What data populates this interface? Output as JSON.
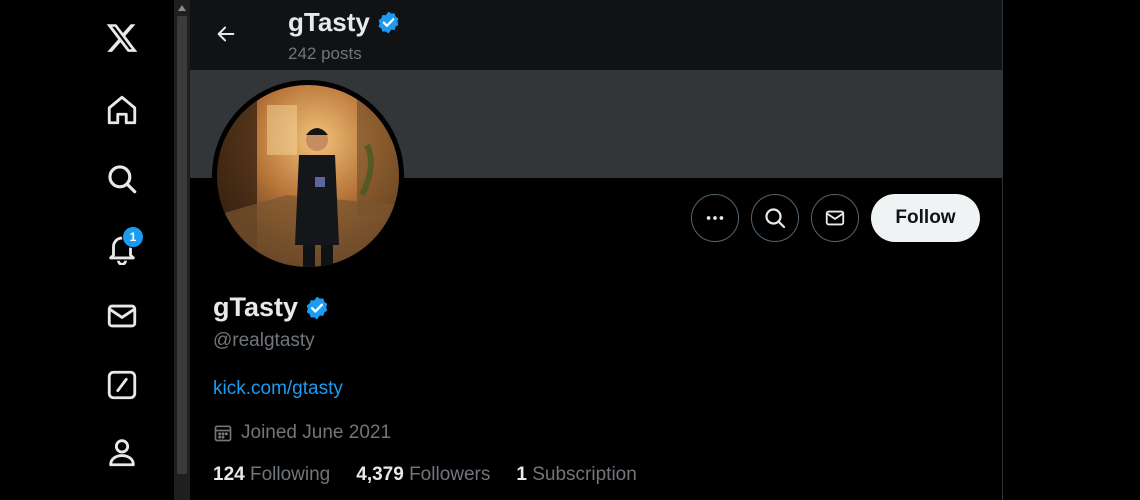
{
  "header": {
    "name": "gTasty",
    "posts": "242 posts"
  },
  "badges": {
    "notifications": "1"
  },
  "profile": {
    "name": "gTasty",
    "handle": "@realgtasty",
    "link": "kick.com/gtasty",
    "joined": "Joined June 2021",
    "follow_label": "Follow"
  },
  "stats": {
    "following_count": "124",
    "following_label": "Following",
    "followers_count": "4,379",
    "followers_label": "Followers",
    "subscription_count": "1",
    "subscription_label": "Subscription"
  },
  "colors": {
    "accent": "#1d9bf0",
    "background": "#000000",
    "banner": "#333639"
  },
  "icons": [
    "x-logo-icon",
    "home-icon",
    "search-icon",
    "bell-icon",
    "mail-icon",
    "grok-icon",
    "profile-icon",
    "back-arrow-icon",
    "verified-badge-icon",
    "more-icon",
    "calendar-icon"
  ]
}
